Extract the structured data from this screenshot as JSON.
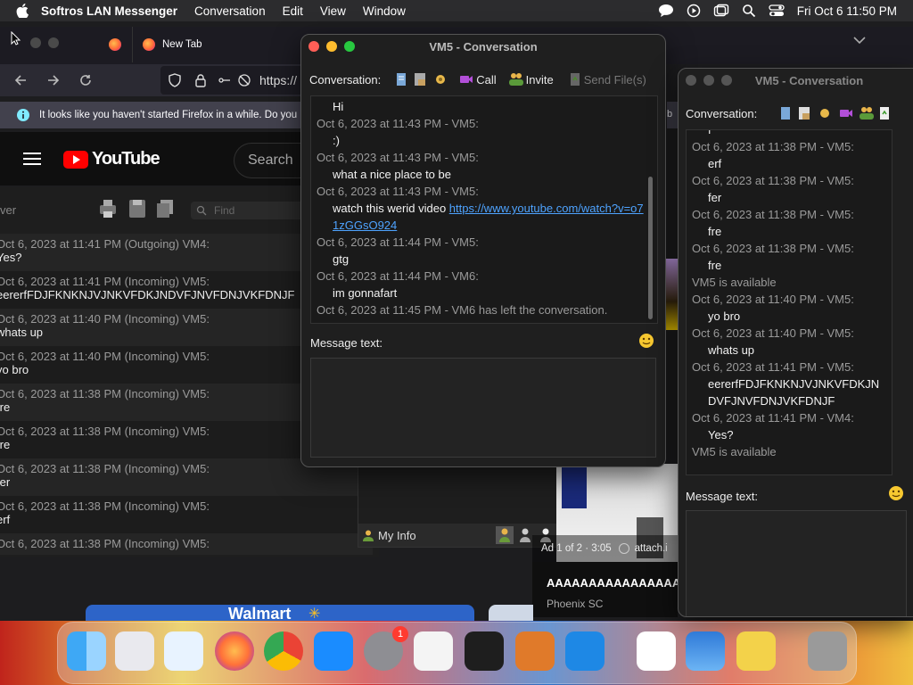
{
  "menubar": {
    "app_name": "Softros LAN Messenger",
    "menus": [
      "Conversation",
      "Edit",
      "View",
      "Window"
    ],
    "datetime": "Fri Oct 6  11:50 PM"
  },
  "firefox": {
    "tab_new": "New Tab",
    "url_prefix": "https://",
    "notification": "It looks like you haven't started Firefox in a while. Do you",
    "youtube_search": "Search",
    "youtube_logo": "YouTube"
  },
  "lan_main": {
    "search_placeholder": "Find",
    "log": [
      {
        "h": "Oct 6, 2023 at 11:41 PM (Outgoing) VM4:",
        "t": "Yes?"
      },
      {
        "h": "Oct 6, 2023 at 11:41 PM (Incoming) VM5:",
        "t": "eererfFDJFKNKNJVJNKVFDKJNDVFJNVFDNJVKFDNJF"
      },
      {
        "h": "Oct 6, 2023 at 11:40 PM (Incoming) VM5:",
        "t": "whats up"
      },
      {
        "h": "Oct 6, 2023 at 11:40 PM (Incoming) VM5:",
        "t": "yo bro"
      },
      {
        "h": "Oct 6, 2023 at 11:38 PM (Incoming) VM5:",
        "t": "fre"
      },
      {
        "h": "Oct 6, 2023 at 11:38 PM (Incoming) VM5:",
        "t": "fre"
      },
      {
        "h": "Oct 6, 2023 at 11:38 PM (Incoming) VM5:",
        "t": "fer"
      },
      {
        "h": "Oct 6, 2023 at 11:38 PM (Incoming) VM5:",
        "t": "erf"
      },
      {
        "h": "Oct 6, 2023 at 11:38 PM (Incoming) VM5:",
        "t": ""
      }
    ],
    "my_info": "My Info"
  },
  "conv1": {
    "title": "VM5 - Conversation",
    "label": "Conversation:",
    "call": "Call",
    "invite": "Invite",
    "send_files": "Send File(s)",
    "lines": [
      {
        "kind": "t",
        "text": "Hi"
      },
      {
        "kind": "h",
        "text": "Oct 6, 2023 at 11:43 PM - VM5:"
      },
      {
        "kind": "t",
        "text": ":)"
      },
      {
        "kind": "h",
        "text": "Oct 6, 2023 at 11:43 PM - VM5:"
      },
      {
        "kind": "t",
        "text": "what a nice place to be"
      },
      {
        "kind": "h",
        "text": "Oct 6, 2023 at 11:43 PM - VM5:"
      },
      {
        "kind": "t",
        "text": "watch this werid video "
      },
      {
        "kind": "h",
        "text": "Oct 6, 2023 at 11:44 PM - VM5:"
      },
      {
        "kind": "t",
        "text": "gtg"
      },
      {
        "kind": "h",
        "text": "Oct 6, 2023 at 11:44 PM - VM6:"
      },
      {
        "kind": "t",
        "text": "im gonnafart"
      },
      {
        "kind": "h",
        "text": "Oct 6, 2023 at 11:45 PM - VM6 has left the conversation."
      }
    ],
    "link": "https://www.youtube.com/watch?v=o71zGGsO924",
    "message_label": "Message text:"
  },
  "conv2": {
    "title": "VM5 - Conversation",
    "label": "Conversation:",
    "lines": [
      {
        "kind": "t",
        "text": "f"
      },
      {
        "kind": "h",
        "text": "Oct 6, 2023 at 11:38 PM - VM5:"
      },
      {
        "kind": "t",
        "text": "erf"
      },
      {
        "kind": "h",
        "text": "Oct 6, 2023 at 11:38 PM - VM5:"
      },
      {
        "kind": "t",
        "text": "fer"
      },
      {
        "kind": "h",
        "text": "Oct 6, 2023 at 11:38 PM - VM5:"
      },
      {
        "kind": "t",
        "text": "fre"
      },
      {
        "kind": "h",
        "text": "Oct 6, 2023 at 11:38 PM - VM5:"
      },
      {
        "kind": "t",
        "text": "fre"
      },
      {
        "kind": "h",
        "text": "VM5 is available"
      },
      {
        "kind": "h",
        "text": "Oct 6, 2023 at 11:40 PM - VM5:"
      },
      {
        "kind": "t",
        "text": "yo bro"
      },
      {
        "kind": "h",
        "text": "Oct 6, 2023 at 11:40 PM - VM5:"
      },
      {
        "kind": "t",
        "text": "whats up"
      },
      {
        "kind": "h",
        "text": "Oct 6, 2023 at 11:41 PM - VM5:"
      },
      {
        "kind": "t",
        "text": "eererfFDJFKNKNJVJNKVFDKJN"
      },
      {
        "kind": "t",
        "text": "DVFJNVFDNJVKFDNJF"
      },
      {
        "kind": "h",
        "text": "Oct 6, 2023 at 11:41 PM - VM4:"
      },
      {
        "kind": "t",
        "text": "Yes?"
      },
      {
        "kind": "h",
        "text": "VM5 is available"
      }
    ],
    "message_label": "Message text:"
  },
  "youtube_bg": {
    "video_counter": "Ad 1 of 2 · 3:05",
    "attach": "attach.i",
    "title": "AAAAAAAAAAAAAAAA",
    "channel": "Phoenix SC",
    "walmart": "Walmart"
  },
  "dock": {
    "items": [
      "finder-icon",
      "launchpad-icon",
      "safari-icon",
      "firefox-icon",
      "chrome-icon",
      "app-store-icon",
      "system-settings-icon",
      "textedit-icon",
      "terminal-icon",
      "garageband-icon",
      "vscode-icon",
      "visual-studio-icon",
      "weather-icon",
      "lan-messenger-icon",
      "trash-icon"
    ],
    "settings_badge": "1"
  }
}
